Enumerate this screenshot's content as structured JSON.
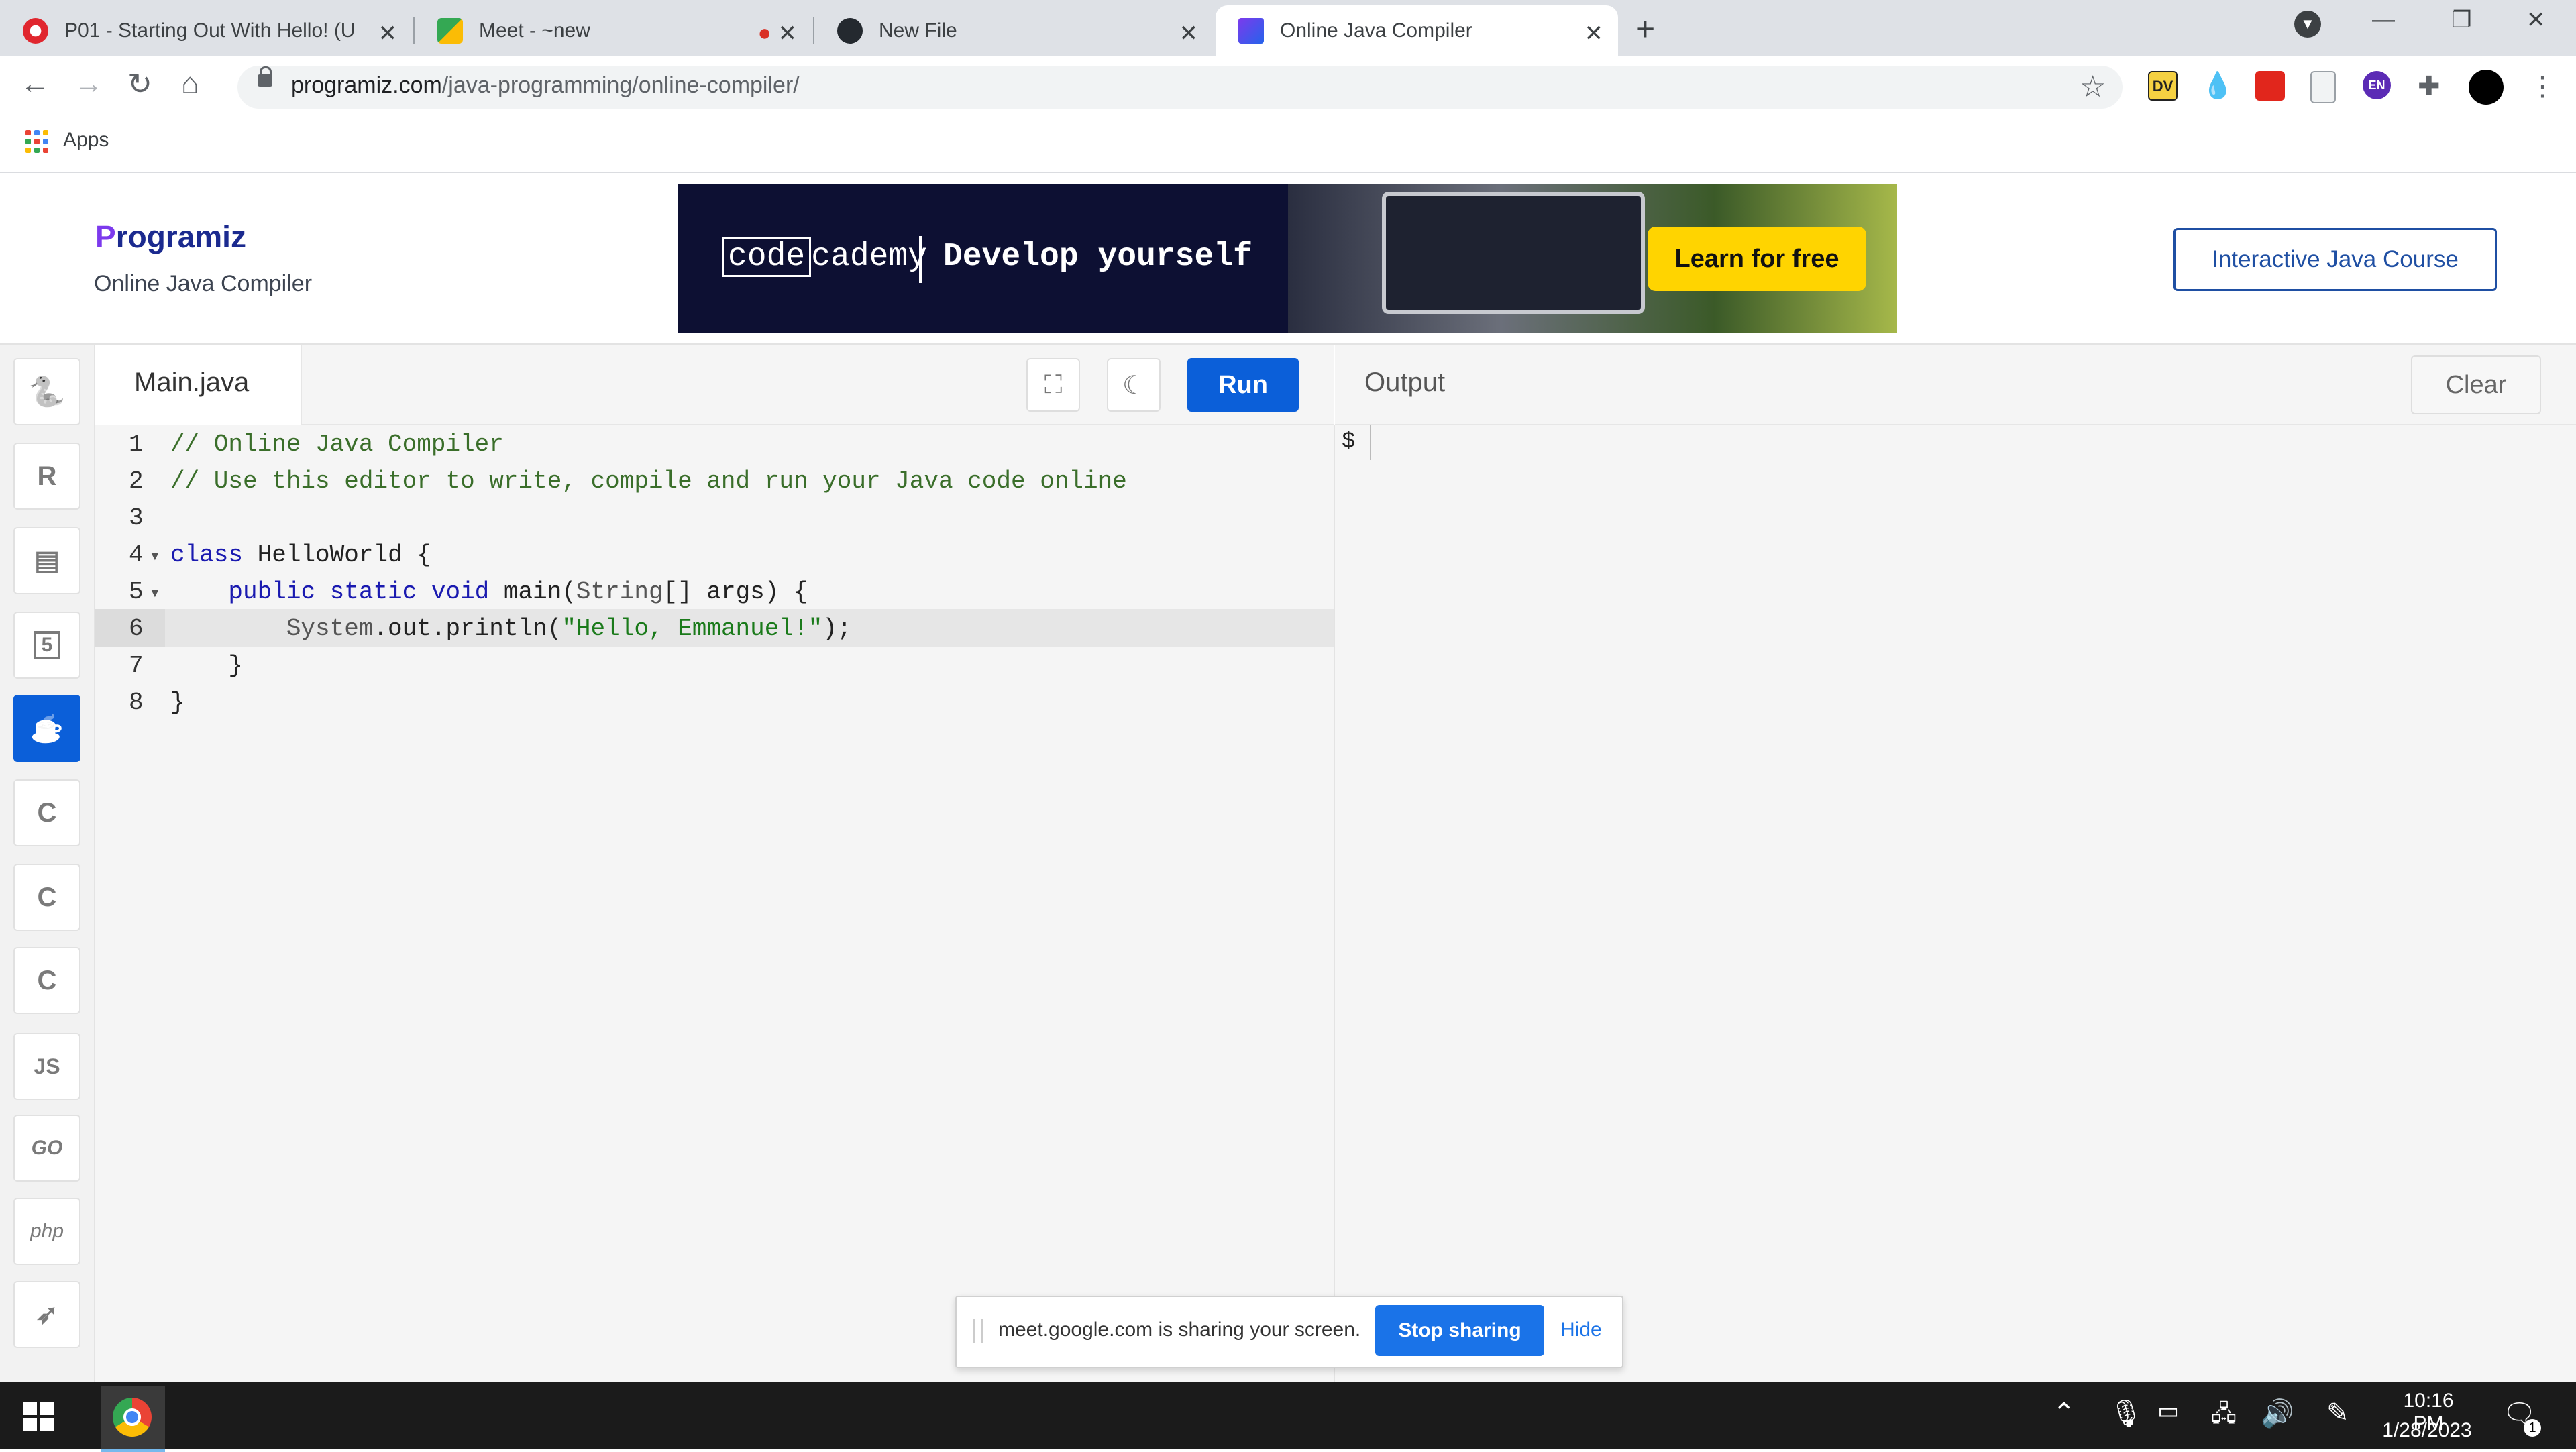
{
  "browser": {
    "tabs": [
      {
        "title": "P01 - Starting Out With Hello! (U",
        "favicon": "coursera-icon",
        "active": false
      },
      {
        "title": "Meet - ~new",
        "favicon": "google-meet-icon",
        "active": false
      },
      {
        "title": "New File",
        "favicon": "github-icon",
        "active": false
      },
      {
        "title": "Online Java Compiler",
        "favicon": "programiz-icon",
        "active": true
      }
    ],
    "url_domain": "programiz.com",
    "url_path": "/java-programming/online-compiler/",
    "bookmarks_label": "Apps",
    "extensions": [
      "DV",
      "EN"
    ]
  },
  "site": {
    "logo_p": "P",
    "logo_rest": "rogramiz",
    "subtitle": "Online Java Compiler",
    "course_button": "Interactive Java Course",
    "ad": {
      "code": "code",
      "cademy": "cademy",
      "tagline": "Develop yourself",
      "cta": "Learn for free"
    }
  },
  "languages": [
    {
      "name": "python-icon",
      "glyph": "🐍"
    },
    {
      "name": "r-icon",
      "glyph": "R"
    },
    {
      "name": "sql-database-icon",
      "glyph": "▤"
    },
    {
      "name": "html5-icon",
      "glyph": "5"
    },
    {
      "name": "java-icon",
      "glyph": "☕"
    },
    {
      "name": "c-icon",
      "glyph": "C"
    },
    {
      "name": "cpp-icon",
      "glyph": "C"
    },
    {
      "name": "csharp-icon",
      "glyph": "C"
    },
    {
      "name": "javascript-icon",
      "glyph": "JS"
    },
    {
      "name": "go-icon",
      "glyph": "GO"
    },
    {
      "name": "php-icon",
      "glyph": "php"
    },
    {
      "name": "swift-icon",
      "glyph": "➶"
    }
  ],
  "editor": {
    "filename": "Main.java",
    "run_label": "Run",
    "lines": [
      {
        "n": "1",
        "parts": [
          [
            "cm",
            "// Online Java Compiler"
          ]
        ]
      },
      {
        "n": "2",
        "parts": [
          [
            "cm",
            "// Use this editor to write, compile and run your Java code online"
          ]
        ]
      },
      {
        "n": "3",
        "parts": []
      },
      {
        "n": "4",
        "parts": [
          [
            "kw",
            "class"
          ],
          [
            "",
            " HelloWorld {"
          ]
        ]
      },
      {
        "n": "5",
        "parts": [
          [
            "",
            "    "
          ],
          [
            "kw",
            "public static void"
          ],
          [
            "",
            " main("
          ],
          [
            "ty",
            "String"
          ],
          [
            "",
            "[] args) {"
          ]
        ]
      },
      {
        "n": "6",
        "parts": [
          [
            "",
            "        "
          ],
          [
            "ty",
            "System"
          ],
          [
            "",
            ".out.println("
          ],
          [
            "str",
            "\"Hello, Emmanuel!\""
          ],
          [
            "",
            ");"
          ]
        ]
      },
      {
        "n": "7",
        "parts": [
          [
            "",
            "    }"
          ]
        ]
      },
      {
        "n": "8",
        "parts": [
          [
            "",
            "}"
          ]
        ]
      }
    ]
  },
  "output": {
    "label": "Output",
    "clear_label": "Clear",
    "prompt": "$"
  },
  "sharing": {
    "message": "meet.google.com is sharing your screen.",
    "stop_label": "Stop sharing",
    "hide_label": "Hide"
  },
  "taskbar": {
    "time": "10:16 PM",
    "date": "1/28/2023",
    "notification_count": "1"
  }
}
